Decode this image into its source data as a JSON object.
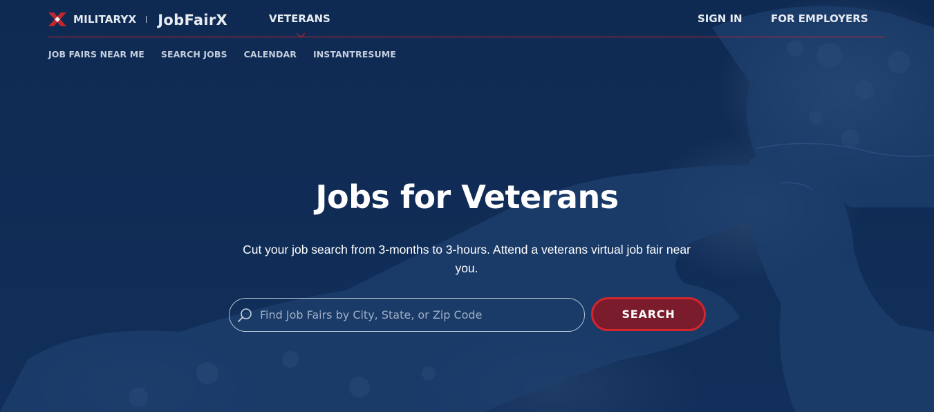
{
  "brand": {
    "militaryx": "MILITARYX",
    "jobfairx": "JobFairX"
  },
  "topnav": {
    "veterans": "VETERANS",
    "sign_in": "SIGN IN",
    "for_employers": "FOR EMPLOYERS"
  },
  "subnav": {
    "items": [
      {
        "label": "JOB FAIRS NEAR ME"
      },
      {
        "label": "SEARCH JOBS"
      },
      {
        "label": "CALENDAR"
      },
      {
        "label": "INSTANTRESUME"
      }
    ]
  },
  "hero": {
    "headline": "Jobs for Veterans",
    "subhead": "Cut your job search from 3-months to 3-hours. Attend a veterans virtual job fair near you."
  },
  "search": {
    "placeholder": "Find Job Fairs by City, State, or Zip Code",
    "value": "",
    "button_label": "SEARCH"
  },
  "colors": {
    "background": "#0f2d55",
    "accent": "#d3262d",
    "button_fill": "#7a1c2c"
  }
}
